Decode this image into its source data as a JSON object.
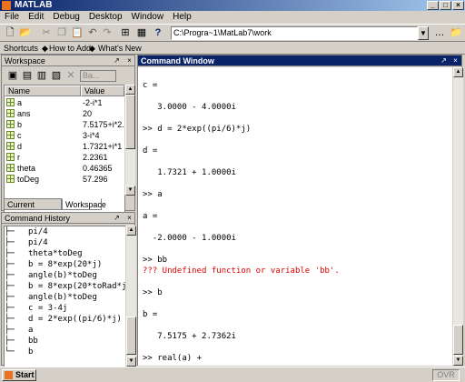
{
  "window": {
    "title": "MATLAB",
    "min": "_",
    "max": "□",
    "close": "×"
  },
  "menu": [
    "File",
    "Edit",
    "Debug",
    "Desktop",
    "Window",
    "Help"
  ],
  "toolbar": {
    "current_dir": "C:\\Progra~1\\MatLab7\\work",
    "help_glyph": "?"
  },
  "shortcuts": {
    "label": "Shortcuts",
    "items": [
      "How to Add",
      "What's New"
    ]
  },
  "workspace": {
    "title": "Workspace",
    "stack_label": "Ba...",
    "columns": [
      "Name",
      "Value"
    ],
    "rows": [
      {
        "name": "a",
        "value": "-2-i*1"
      },
      {
        "name": "ans",
        "value": "20"
      },
      {
        "name": "b",
        "value": "7.5175+i*2."
      },
      {
        "name": "c",
        "value": "3-i*4"
      },
      {
        "name": "d",
        "value": "1.7321+i*1"
      },
      {
        "name": "r",
        "value": "2.2361"
      },
      {
        "name": "theta",
        "value": "0.46365"
      },
      {
        "name": "toDeg",
        "value": "57.296"
      }
    ],
    "tabs": [
      "Current Directory",
      "Workspace"
    ]
  },
  "history": {
    "title": "Command History",
    "lines": [
      "pi/4",
      "pi/4",
      "theta*toDeg",
      "b = 8*exp(20*j)",
      "angle(b)*toDeg",
      "b = 8*exp(20*toRad*j",
      "angle(b)*toDeg",
      "c = 3-4j",
      "d = 2*exp((pi/6)*j)",
      "a",
      "bb",
      "b"
    ]
  },
  "command": {
    "title": "Command Window",
    "lines": [
      {
        "text": "c =",
        "err": false
      },
      {
        "text": "",
        "err": false
      },
      {
        "text": "   3.0000 - 4.0000i",
        "err": false
      },
      {
        "text": "",
        "err": false
      },
      {
        "text": ">> d = 2*exp((pi/6)*j)",
        "err": false
      },
      {
        "text": "",
        "err": false
      },
      {
        "text": "d =",
        "err": false
      },
      {
        "text": "",
        "err": false
      },
      {
        "text": "   1.7321 + 1.0000i",
        "err": false
      },
      {
        "text": "",
        "err": false
      },
      {
        "text": ">> a",
        "err": false
      },
      {
        "text": "",
        "err": false
      },
      {
        "text": "a =",
        "err": false
      },
      {
        "text": "",
        "err": false
      },
      {
        "text": "  -2.0000 - 1.0000i",
        "err": false
      },
      {
        "text": "",
        "err": false
      },
      {
        "text": ">> bb",
        "err": false
      },
      {
        "text": "??? Undefined function or variable 'bb'.",
        "err": true
      },
      {
        "text": "",
        "err": false
      },
      {
        "text": ">> b",
        "err": false
      },
      {
        "text": "",
        "err": false
      },
      {
        "text": "b =",
        "err": false
      },
      {
        "text": "",
        "err": false
      },
      {
        "text": "   7.5175 + 2.7362i",
        "err": false
      },
      {
        "text": "",
        "err": false
      },
      {
        "text": ">> real(a) +",
        "err": false
      }
    ]
  },
  "status": {
    "start": "Start",
    "ovr": "OVR"
  }
}
